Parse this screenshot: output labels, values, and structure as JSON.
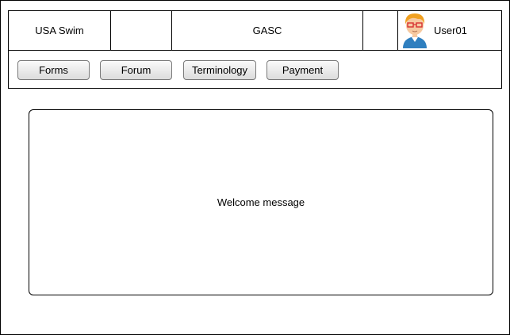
{
  "header": {
    "org_label": "USA Swim",
    "club_label": "GASC",
    "user_label": "User01",
    "avatar_icon": "user-avatar-icon"
  },
  "nav": {
    "buttons": [
      {
        "label": "Forms"
      },
      {
        "label": "Forum"
      },
      {
        "label": "Terminology"
      },
      {
        "label": "Payment"
      }
    ]
  },
  "main": {
    "welcome_text": "Welcome message"
  },
  "colors": {
    "border": "#000000",
    "button_border": "#7a7a7a",
    "avatar_hair": "#f0a020",
    "avatar_shirt": "#2f7fbf",
    "avatar_glasses": "#d83030"
  }
}
